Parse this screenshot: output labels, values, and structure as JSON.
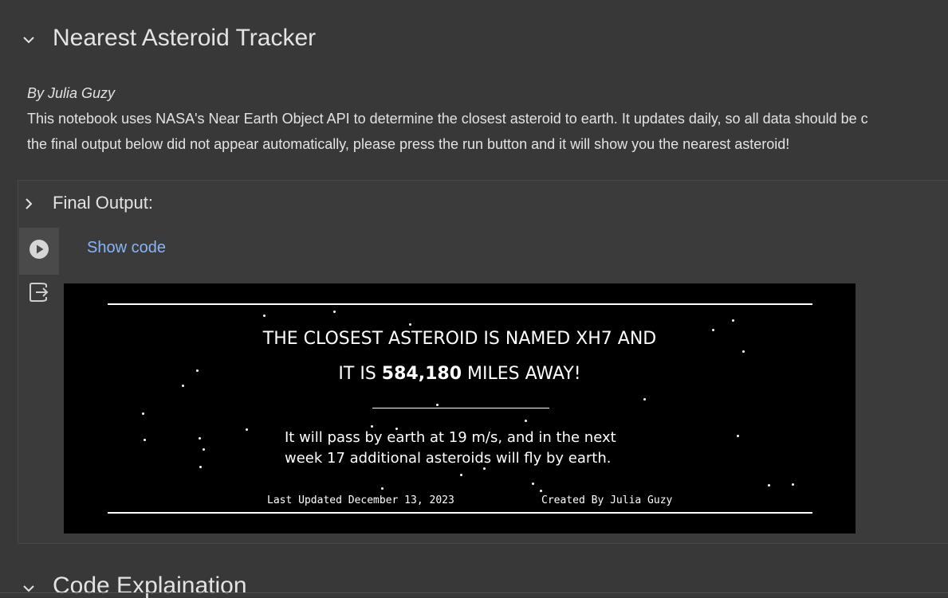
{
  "notebook": {
    "title": "Nearest Asteroid Tracker",
    "byline": "By Julia Guzy",
    "description_line1": "This notebook uses NASA's Near Earth Object API to determine the closest asteroid to earth. It updates daily, so all data should be c",
    "description_line2": "the final output below did not appear automatically, please press the run button and it will show you the nearest asteroid!"
  },
  "cell": {
    "section_title": "Final Output:",
    "show_code_label": "Show code"
  },
  "output": {
    "line1": "THE CLOSEST ASTEROID IS NAMED XH7 AND",
    "line2_prefix": "IT IS ",
    "line2_distance": "584,180",
    "line2_suffix": " MILES AWAY!",
    "sub_line1": "It will pass by earth at 19 m/s, and in the next",
    "sub_line2": "week 17 additional asteroids will fly by earth.",
    "last_updated": "Last Updated December 13, 2023",
    "created_by": "Created By Julia Guzy"
  },
  "next_section": {
    "title": "Code Explaination"
  },
  "icons": {
    "section_collapse": "chevron-down-icon",
    "section_expand": "chevron-right-icon",
    "run": "play-circle-icon",
    "output": "output-exit-icon"
  },
  "colors": {
    "background": "#383838",
    "link": "#8ab4f8",
    "output_bg": "#000000"
  }
}
